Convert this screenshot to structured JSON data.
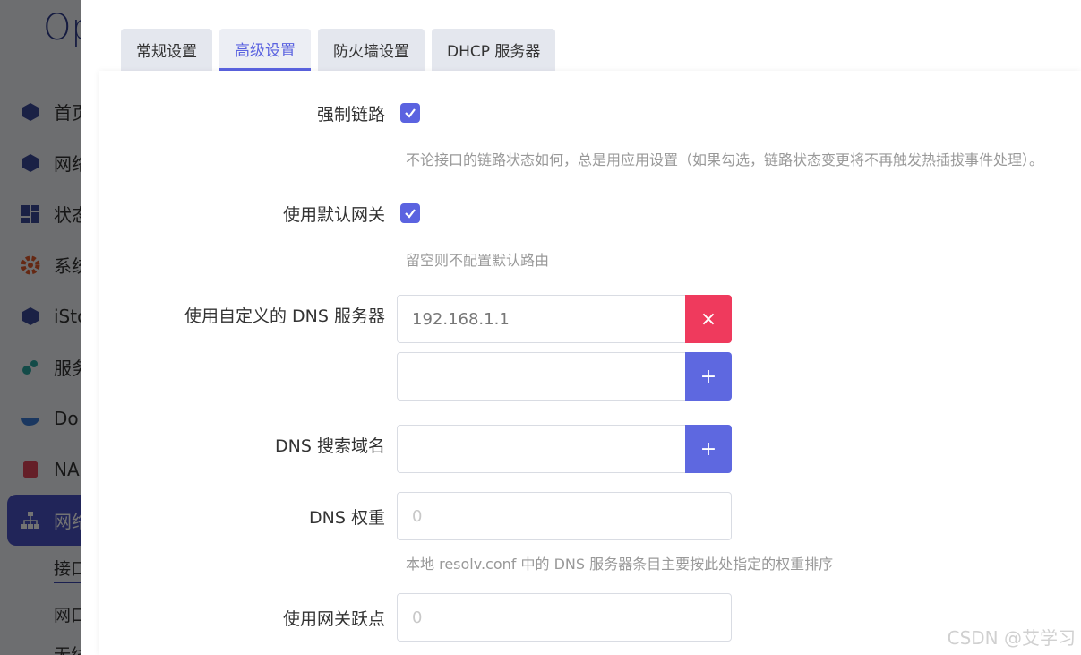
{
  "background": {
    "logo": "Op",
    "nav": [
      {
        "label": "首页",
        "icon": "cube-icon"
      },
      {
        "label": "网络",
        "icon": "cube-icon"
      },
      {
        "label": "状态",
        "icon": "dashboard-icon"
      },
      {
        "label": "系统",
        "icon": "gear-icon"
      },
      {
        "label": "iSto",
        "icon": "cube-icon"
      },
      {
        "label": "服务",
        "icon": "cogs-icon"
      },
      {
        "label": "Do",
        "icon": "docker-icon"
      },
      {
        "label": "NA",
        "icon": "database-icon"
      },
      {
        "label": "网络",
        "icon": "sitemap-icon"
      }
    ],
    "sub": [
      "接口",
      "网口",
      "无线"
    ]
  },
  "tabs": [
    {
      "label": "常规设置",
      "active": false
    },
    {
      "label": "高级设置",
      "active": true
    },
    {
      "label": "防火墙设置",
      "active": false
    },
    {
      "label": "DHCP 服务器",
      "active": false
    }
  ],
  "form": {
    "force_link": {
      "label": "强制链路",
      "checked": true,
      "hint": "不论接口的链路状态如何，总是用应用设置（如果勾选，链路状态变更将不再触发热插拔事件处理）。"
    },
    "default_gateway": {
      "label": "使用默认网关",
      "checked": true,
      "hint": "留空则不配置默认路由"
    },
    "custom_dns": {
      "label": "使用自定义的 DNS 服务器",
      "values": [
        "192.168.1.1",
        ""
      ],
      "remove_symbol": "×",
      "add_symbol": "+"
    },
    "dns_search": {
      "label": "DNS 搜索域名",
      "value": "",
      "add_symbol": "+"
    },
    "dns_weight": {
      "label": "DNS 权重",
      "placeholder": "0",
      "hint": "本地 resolv.conf 中的 DNS 服务器条目主要按此处指定的权重排序"
    },
    "gateway_metric": {
      "label": "使用网关跃点",
      "placeholder": "0"
    }
  },
  "watermark": "CSDN @艾学习",
  "colors": {
    "accent": "#5b63e0",
    "danger": "#ef3a5d",
    "overlay": "rgba(0,0,0,0.55)"
  }
}
